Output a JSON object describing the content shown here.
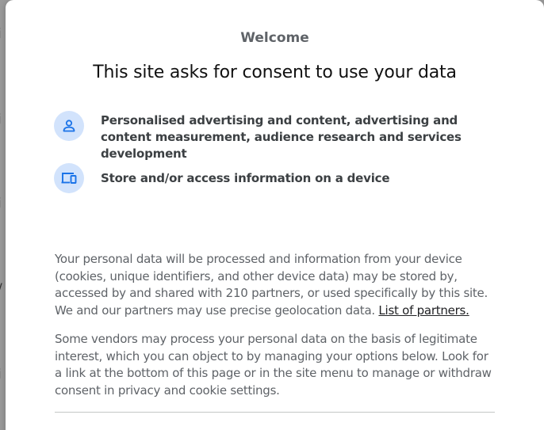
{
  "dialog": {
    "welcome": "Welcome",
    "headline": "This site asks for consent to use your data",
    "purposes": [
      {
        "icon": "person-icon",
        "text": "Personalised advertising and content, advertising and content measurement, audience research and services development"
      },
      {
        "icon": "devices-icon",
        "text": "Store and/or access information on a device"
      }
    ],
    "paragraph1": {
      "text": "Your personal data will be processed and information from your device (cookies, unique identifiers, and other device data) may be stored by, accessed by and shared with 210 partners, or used specifically by this site. We and our partners may use precise geolocation data. ",
      "link_label": "List of partners."
    },
    "paragraph2": "Some vendors may process your personal data on the basis of legitimate interest, which you can object to by managing your options below. Look for a link at the bottom of this page or in the site menu to manage or withdraw consent in privacy and cookie settings."
  },
  "colors": {
    "icon_bg": "#d2e3fc",
    "icon_fg": "#1a73e8",
    "text_muted": "#5f6368",
    "text_strong": "#3c4043"
  }
}
